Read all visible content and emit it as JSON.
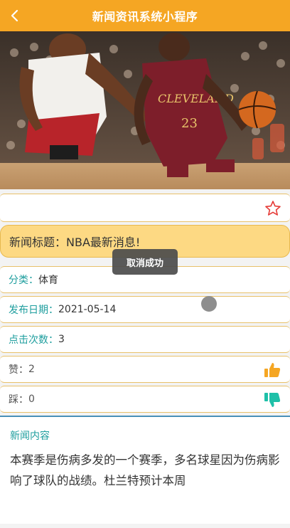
{
  "nav": {
    "title": "新闻资讯系统小程序",
    "back_icon": "chevron-left-icon"
  },
  "hero": {
    "alt": "basketball-photo"
  },
  "favorite": {
    "icon": "star-outline-icon",
    "color": "#e53935"
  },
  "news": {
    "title_label": "新闻标题：",
    "title_value": "NBA最新消息!",
    "category_label": "分类：",
    "category_value": "体育",
    "date_label": "发布日期：",
    "date_value": "2021-05-14",
    "clicks_label": "点击次数：",
    "clicks_value": "3",
    "likes_label": "赞：",
    "likes_value": "2",
    "dislikes_label": "踩：",
    "dislikes_value": "0",
    "content_label": "新闻内容",
    "content_text": "本赛季是伤病多发的一个赛季，多名球星因为伤病影响了球队的战绩。杜兰特预计本周"
  },
  "toast": {
    "text": "取消成功"
  },
  "colors": {
    "accent": "#f5a623",
    "teal": "#1e9e9e",
    "like": "#f5a623",
    "dislike": "#1ec0a8"
  }
}
